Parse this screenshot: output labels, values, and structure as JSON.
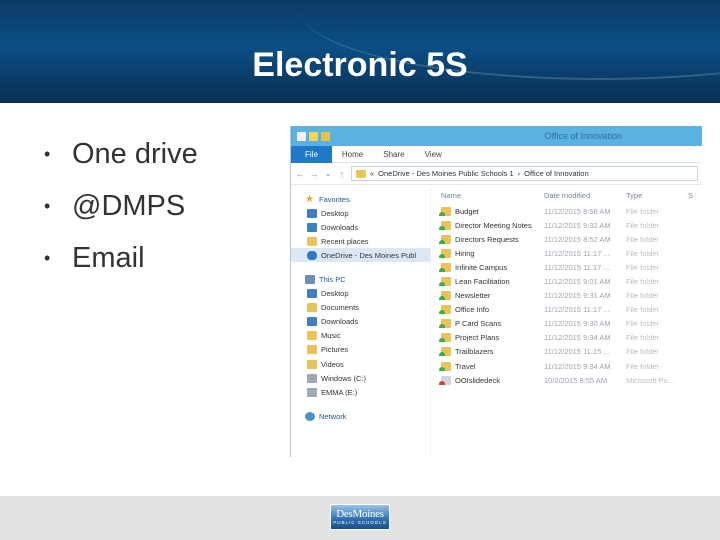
{
  "slide": {
    "title": "Electronic 5S",
    "bullets": [
      "One drive",
      "@DMPS",
      "Email"
    ]
  },
  "explorer": {
    "window_title": "Office of Innovation",
    "ribbon_tabs": [
      "File",
      "Home",
      "Share",
      "View"
    ],
    "address_path": {
      "prefix": "«",
      "segment1": "OneDrive - Des Moines Public Schools 1",
      "separator": "›",
      "segment2": "Office of Innovation"
    },
    "nav": {
      "favorites_label": "Favorites",
      "favorites": [
        "Desktop",
        "Downloads",
        "Recent places",
        "OneDrive - Des Moines Publ"
      ],
      "thispc_label": "This PC",
      "thispc": [
        "Desktop",
        "Documents",
        "Downloads",
        "Music",
        "Pictures",
        "Videos",
        "Windows (C:)",
        "EMMA (E:)"
      ],
      "network_label": "Network"
    },
    "columns": {
      "name": "Name",
      "date": "Date modified",
      "type": "Type",
      "size": "S"
    },
    "files": [
      {
        "name": "Budget",
        "date": "11/12/2015 8:56 AM",
        "type": "File folder"
      },
      {
        "name": "Director Meeting Notes",
        "date": "11/12/2015 9:32 AM",
        "type": "File folder"
      },
      {
        "name": "Directors Requests",
        "date": "11/12/2015 8:52 AM",
        "type": "File folder"
      },
      {
        "name": "Hiring",
        "date": "11/12/2015 11:17 ...",
        "type": "File folder"
      },
      {
        "name": "Infinite Campus",
        "date": "11/12/2015 11:17 ...",
        "type": "File folder"
      },
      {
        "name": "Lean Facilitation",
        "date": "11/12/2015 9:01 AM",
        "type": "File folder"
      },
      {
        "name": "Newsletter",
        "date": "11/12/2015 9:31 AM",
        "type": "File folder"
      },
      {
        "name": "Office Info",
        "date": "11/12/2015 11:17 ...",
        "type": "File folder"
      },
      {
        "name": "P Card Scans",
        "date": "11/12/2015 9:30 AM",
        "type": "File folder"
      },
      {
        "name": "Project Plans",
        "date": "11/12/2015 9:34 AM",
        "type": "File folder"
      },
      {
        "name": "Trailblazers",
        "date": "11/12/2015 11:15 ...",
        "type": "File folder"
      },
      {
        "name": "Travel",
        "date": "11/12/2015 9:34 AM",
        "type": "File folder"
      },
      {
        "name": "OOIslidedeck",
        "date": "10/2/2015 8:55 AM",
        "type": "Microsoft Po..."
      }
    ]
  },
  "footer": {
    "logo_line1": "DesMoines",
    "logo_line2": "PUBLIC SCHOOLS"
  },
  "colors": {
    "header_blue": "#0b4f86",
    "explorer_titlebar": "#59b2e0",
    "file_tab": "#1f79c8",
    "footer_gray": "#e2e2e2"
  }
}
